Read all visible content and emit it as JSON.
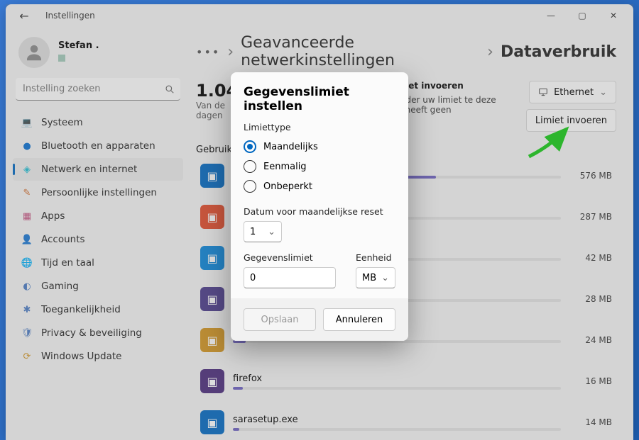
{
  "window": {
    "title": "Instellingen"
  },
  "win_controls": {
    "min": "—",
    "max": "▢",
    "close": "✕"
  },
  "user": {
    "name": "Stefan ."
  },
  "search": {
    "placeholder": "Instelling zoeken"
  },
  "nav": [
    {
      "icon": "💻",
      "label": "Systeem",
      "color": "#3a60a8"
    },
    {
      "icon": "●",
      "label": "Bluetooth en apparaten",
      "color": "#0a6fd0"
    },
    {
      "icon": "◈",
      "label": "Netwerk en internet",
      "color": "#1fbcd2",
      "active": true
    },
    {
      "icon": "✎",
      "label": "Persoonlijke instellingen",
      "color": "#d06a2a"
    },
    {
      "icon": "▦",
      "label": "Apps",
      "color": "#c24a7a"
    },
    {
      "icon": "👤",
      "label": "Accounts",
      "color": "#4a7ac2"
    },
    {
      "icon": "🌐",
      "label": "Tijd en taal",
      "color": "#d0931f"
    },
    {
      "icon": "◐",
      "label": "Gaming",
      "color": "#4a7ac2"
    },
    {
      "icon": "✱",
      "label": "Toegankelijkheid",
      "color": "#4a7ac2"
    },
    {
      "icon": "🛡",
      "label": "Privacy & beveiliging",
      "color": "#4a7ac2"
    },
    {
      "icon": "⟳",
      "label": "Windows Update",
      "color": "#d0931f"
    }
  ],
  "breadcrumb": {
    "more": "•••",
    "parent": "Geavanceerde netwerkinstellingen",
    "current": "Dataverbruik"
  },
  "usage": {
    "total": "1.04 GB",
    "period_prefix": "Van de",
    "period_suffix": "dagen"
  },
  "limit_box": {
    "title": "Gegevenslimiet invoeren",
    "desc_tail": "te houden om onder uw limiet te deze nadert, maar dit heeft geen"
  },
  "buttons": {
    "ethernet": "Ethernet",
    "enter_limit": "Limiet invoeren"
  },
  "usage_label": "Gebruik",
  "apps": [
    {
      "name": "",
      "size": "576 MB",
      "pct": 62,
      "bg": "#0067c0"
    },
    {
      "name": "",
      "size": "287 MB",
      "pct": 32,
      "bg": "#e04a2a"
    },
    {
      "name": "",
      "size": "42 MB",
      "pct": 6,
      "bg": "#0a84d8"
    },
    {
      "name": "",
      "size": "28 MB",
      "pct": 4,
      "bg": "#4a3a8a"
    },
    {
      "name": "",
      "size": "24 MB",
      "pct": 4,
      "bg": "#d0931f"
    },
    {
      "name": "firefox",
      "size": "16 MB",
      "pct": 3,
      "bg": "#4a2a7a"
    },
    {
      "name": "sarasetup.exe",
      "size": "14 MB",
      "pct": 2,
      "bg": "#0067c0"
    }
  ],
  "dialog": {
    "title": "Gegevenslimiet instellen",
    "limit_type_label": "Limiettype",
    "options": {
      "monthly": "Maandelijks",
      "once": "Eenmalig",
      "unlimited": "Onbeperkt"
    },
    "reset_label": "Datum voor maandelijkse reset",
    "reset_value": "1",
    "data_limit_label": "Gegevenslimiet",
    "data_limit_value": "0",
    "unit_label": "Eenheid",
    "unit_value": "MB",
    "save": "Opslaan",
    "cancel": "Annuleren"
  }
}
